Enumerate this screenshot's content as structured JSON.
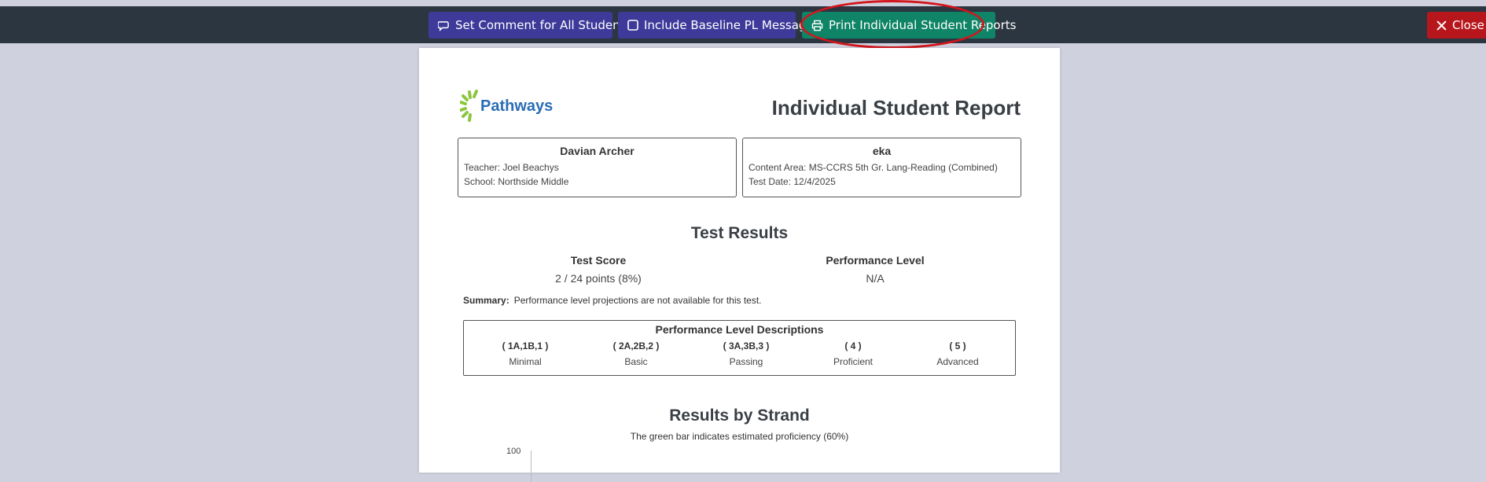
{
  "toolbar": {
    "set_comment_label": "Set Comment for All Students",
    "baseline_label": "Include Baseline PL Message",
    "baseline_checked": false,
    "print_label": "Print Individual Student Reports",
    "close_label": "Close"
  },
  "report": {
    "logo_text": "Pathways",
    "title": "Individual Student Report",
    "student": {
      "name": "Davian Archer",
      "teacher": "Teacher: Joel Beachys",
      "school": "School: Northside Middle"
    },
    "test": {
      "name": "eka",
      "content_area": "Content Area: MS-CCRS 5th Gr. Lang-Reading (Combined)",
      "test_date": "Test Date: 12/4/2025"
    },
    "test_results_title": "Test Results",
    "test_score_label": "Test Score",
    "test_score_value": "2 / 24 points (8%)",
    "performance_label": "Performance Level",
    "performance_value": "N/A",
    "summary_label": "Summary:",
    "summary_text": "Performance level projections are not available for this test.",
    "pld_title": "Performance Level Descriptions",
    "levels": [
      {
        "code": "( 1A,1B,1 )",
        "name": "Minimal"
      },
      {
        "code": "( 2A,2B,2 )",
        "name": "Basic"
      },
      {
        "code": "( 3A,3B,3 )",
        "name": "Passing"
      },
      {
        "code": "( 4 )",
        "name": "Proficient"
      },
      {
        "code": "( 5 )",
        "name": "Advanced"
      }
    ],
    "strand_title": "Results by Strand",
    "strand_note": "The green bar indicates estimated proficiency (60%)",
    "y_tick_top": "100"
  },
  "colors": {
    "toolbar_bg": "#2b3640",
    "primary_button": "#3d3a9a",
    "print_button": "#0f8466",
    "close_button": "#b7161c",
    "logo_green": "#8cc63f",
    "logo_blue": "#2a6db5",
    "highlight_ring": "#d3151c"
  }
}
